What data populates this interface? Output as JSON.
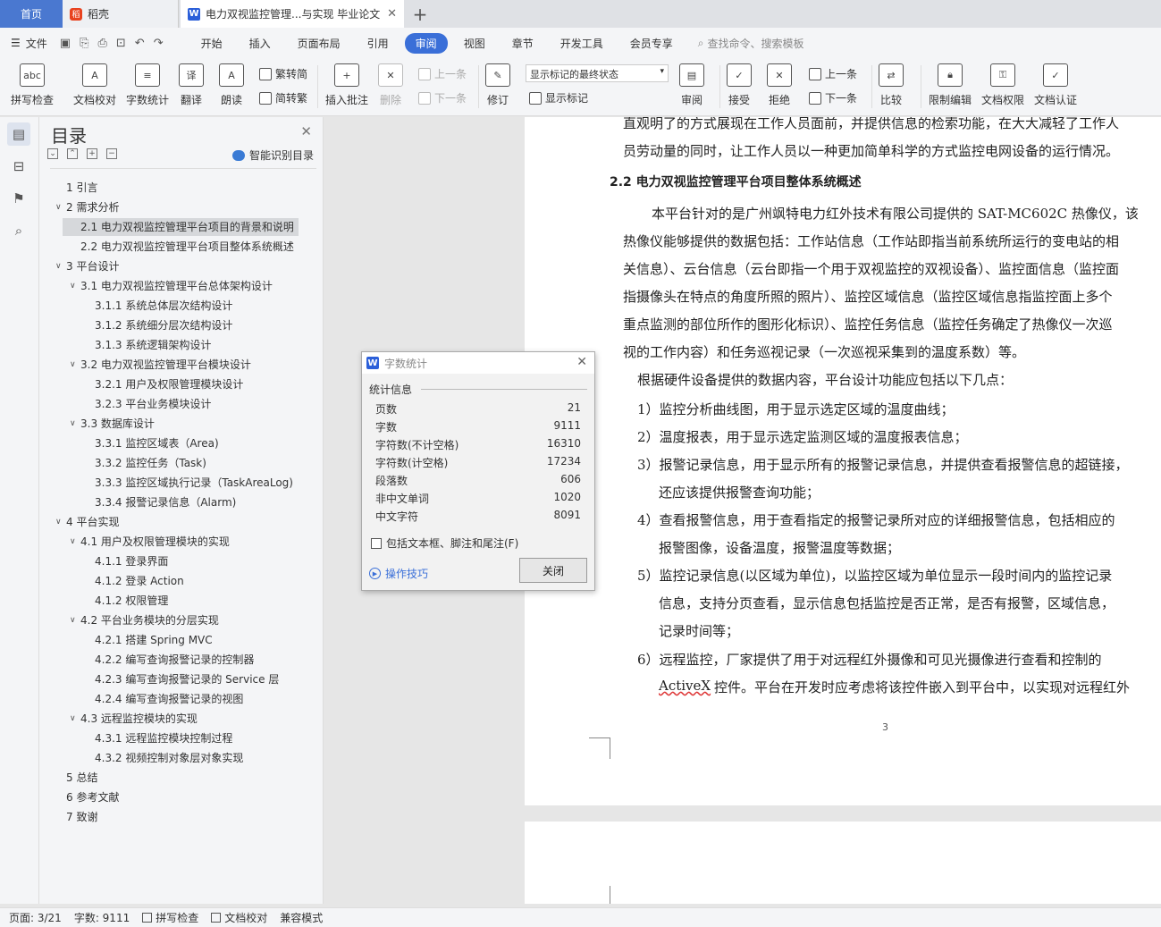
{
  "tabs": {
    "home": "首页",
    "daoke": "稻壳",
    "doc": "电力双视监控管理...与实现 毕业论文"
  },
  "menu": {
    "file": "文件",
    "items": [
      "开始",
      "插入",
      "页面布局",
      "引用",
      "审阅",
      "视图",
      "章节",
      "开发工具",
      "会员专享"
    ],
    "active": "审阅",
    "search": "查找命令、搜索模板"
  },
  "ribbon": {
    "spell": "拼写检查",
    "proof": "文档校对",
    "wordcount": "字数统计",
    "translate": "翻译",
    "read": "朗读",
    "trad": "繁转简",
    "simp": "简转繁",
    "insert_comment": "插入批注",
    "delete": "删除",
    "prev": "上一条",
    "next": "下一条",
    "revise": "修订",
    "markup_state": "显示标记的最终状态",
    "show_markup": "显示标记",
    "review": "审阅",
    "accept": "接受",
    "reject": "拒绝",
    "prev2": "上一条",
    "next2": "下一条",
    "compare": "比较",
    "restrict": "限制编辑",
    "rights": "文档权限",
    "cert": "文档认证"
  },
  "toc": {
    "title": "目录",
    "smart": "智能识别目录",
    "items": [
      "1 引言",
      "2 需求分析",
      "2.1 电力双视监控管理平台项目的背景和说明",
      "2.2 电力双视监控管理平台项目整体系统概述",
      "3 平台设计",
      "3.1 电力双视监控管理平台总体架构设计",
      "3.1.1 系统总体层次结构设计",
      "3.1.2 系统细分层次结构设计",
      "3.1.3 系统逻辑架构设计",
      "3.2 电力双视监控管理平台模块设计",
      "3.2.1 用户及权限管理模块设计",
      "3.2.3 平台业务模块设计",
      "3.3 数据库设计",
      "3.3.1 监控区域表（Area)",
      "3.3.2 监控任务（Task)",
      "3.3.3 监控区域执行记录（TaskAreaLog)",
      "3.3.4 报警记录信息（Alarm)",
      "4 平台实现",
      "4.1 用户及权限管理模块的实现",
      "4.1.1 登录界面",
      "4.1.2 登录 Action",
      "4.1.2 权限管理",
      "4.2 平台业务模块的分层实现",
      "4.2.1 搭建 Spring MVC",
      "4.2.2 编写查询报警记录的控制器",
      "4.2.3 编写查询报警记录的 Service 层",
      "4.2.4 编写查询报警记录的视图",
      "4.3 远程监控模块的实现",
      "4.3.1 远程监控模块控制过程",
      "4.3.2 视频控制对象层对象实现",
      "5 总结",
      "6 参考文献",
      "7 致谢"
    ]
  },
  "doc": {
    "lines": [
      "直观明了的方式展现在工作人员面前，并提供信息的检索功能，在大大减轻了工作人",
      "员劳动量的同时，让工作人员以一种更加简单科学的方式监控电网设备的运行情况。",
      "2.2  电力双视监控管理平台项目整体系统概述",
      "本平台针对的是广州飒特电力红外技术有限公司提供的 SAT-MC602C 热像仪，该",
      "热像仪能够提供的数据包括：工作站信息（工作站即指当前系统所运行的变电站的相",
      "关信息）、云台信息（云台即指一个用于双视监控的双视设备）、监控面信息（监控面",
      "指摄像头在特点的角度所照的照片）、监控区域信息（监控区域信息指监控面上多个",
      "重点监测的部位所作的图形化标识）、监控任务信息（监控任务确定了热像仪一次巡",
      "视的工作内容）和任务巡视记录（一次巡视采集到的温度系数）等。",
      "根据硬件设备提供的数据内容，平台设计功能应包括以下几点：",
      "1）监控分析曲线图，用于显示选定区域的温度曲线；",
      "2）温度报表，用于显示选定监测区域的温度报表信息；",
      "3）报警记录信息，用于显示所有的报警记录信息，并提供查看报警信息的超链接，",
      "还应该提供报警查询功能；",
      "4）查看报警信息，用于查看指定的报警记录所对应的详细报警信息，包括相应的",
      "报警图像，设备温度，报警温度等数据；",
      "5）监控记录信息(以区域为单位)，以监控区域为单位显示一段时间内的监控记录",
      "信息，支持分页查看，显示信息包括监控是否正常，是否有报警，区域信息，",
      "记录时间等；",
      "6）远程监控，厂家提供了用于对远程红外摄像和可见光摄像进行查看和控制的",
      "ActiveX",
      "控件。平台在开发时应考虑将该控件嵌入到平台中，以实现对远程红外"
    ],
    "page_number": "3"
  },
  "dialog": {
    "title": "字数统计",
    "section": "统计信息",
    "rows": [
      {
        "label": "页数",
        "value": "21"
      },
      {
        "label": "字数",
        "value": "9111"
      },
      {
        "label": "字符数(不计空格)",
        "value": "16310"
      },
      {
        "label": "字符数(计空格)",
        "value": "17234"
      },
      {
        "label": "段落数",
        "value": "606"
      },
      {
        "label": "非中文单词",
        "value": "1020"
      },
      {
        "label": "中文字符",
        "value": "8091"
      }
    ],
    "checkbox": "包括文本框、脚注和尾注(F)",
    "tips": "操作技巧",
    "close": "关闭"
  },
  "status": {
    "page": "页面: 3/21",
    "words": "字数: 9111",
    "spell": "拼写检查",
    "proof": "文档校对",
    "compat": "兼容模式"
  },
  "colors": {
    "accent": "#3a6fd8",
    "home_tab": "#4a78d0"
  }
}
